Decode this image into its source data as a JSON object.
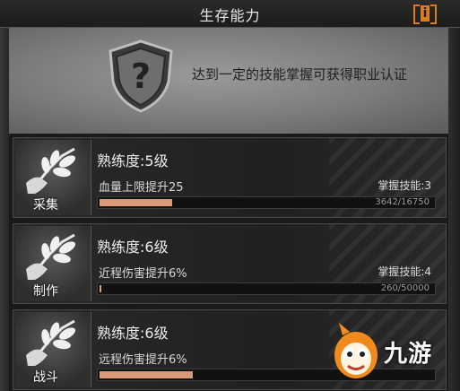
{
  "header": {
    "title": "生存能力",
    "info_glyph": "i"
  },
  "certification": {
    "text": "达到一定的技能掌握可获得职业认证",
    "icon": "question-shield-icon"
  },
  "skills": [
    {
      "label": "采集",
      "level_text": "熟练度:5级",
      "bonus": "血量上限提升25",
      "skills_mastered": "掌握技能:3",
      "progress_text": "3642/16750",
      "progress": 0.217,
      "icon": "branch-hand-icon"
    },
    {
      "label": "制作",
      "level_text": "熟练度:6级",
      "bonus": "近程伤害提升6%",
      "skills_mastered": "掌握技能:4",
      "progress_text": "260/50000",
      "progress": 0.005,
      "icon": "branch-hand-icon"
    },
    {
      "label": "战斗",
      "level_text": "熟练度:6级",
      "bonus": "远程伤害提升6%",
      "progress": 0.28,
      "icon": "branch-hand-icon"
    }
  ],
  "watermark": {
    "text": "九游"
  },
  "colors": {
    "accent": "#e07a1f",
    "progress_fill": "#d89a78"
  }
}
